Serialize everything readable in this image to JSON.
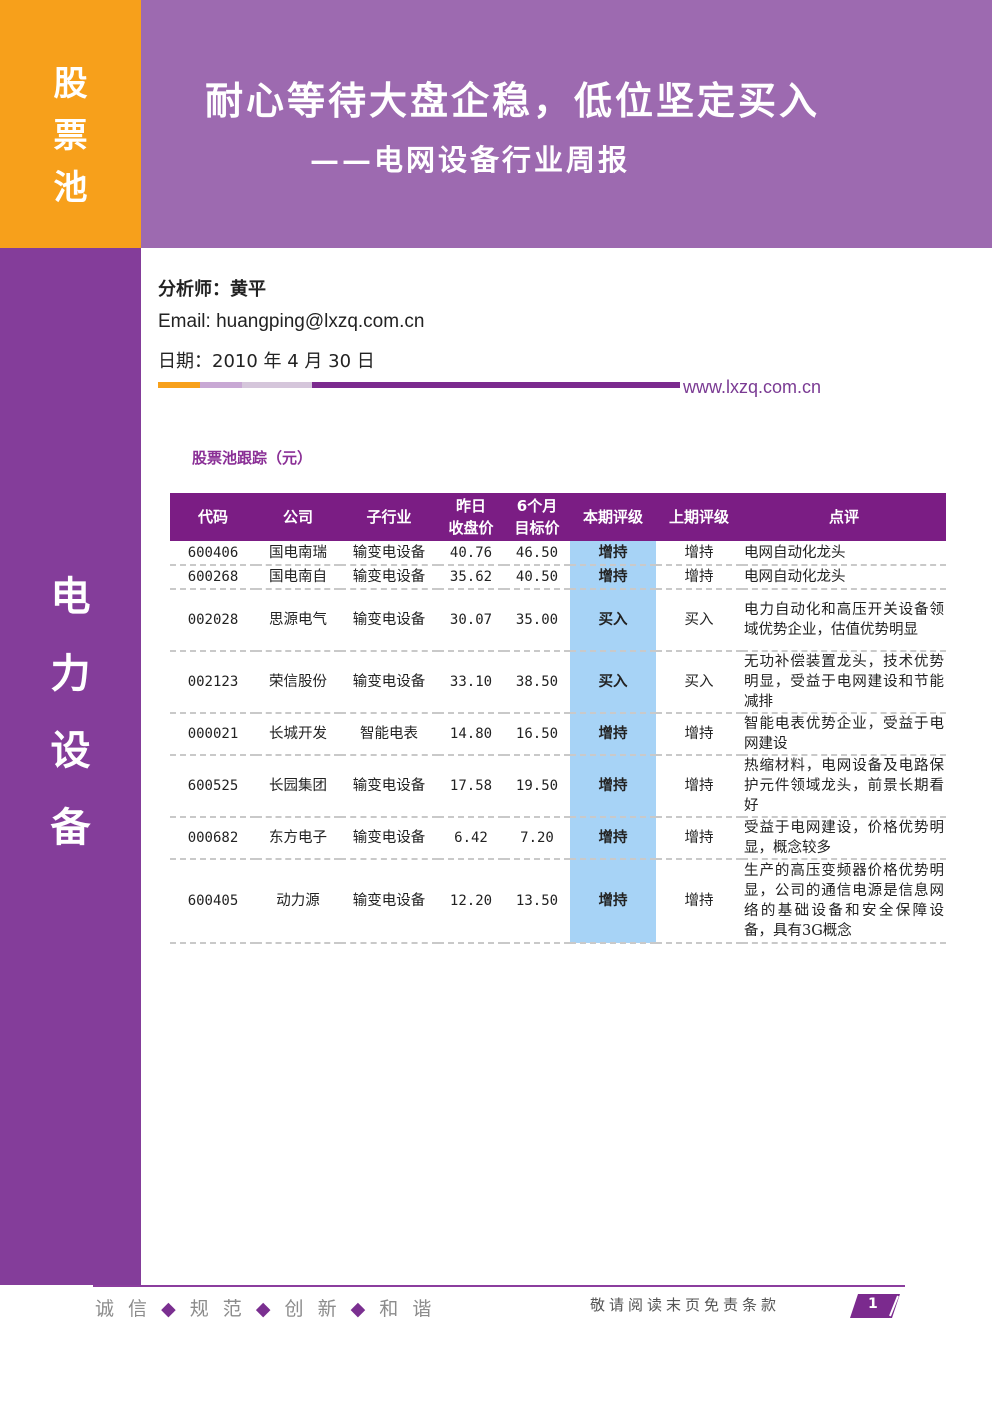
{
  "sidebar_top": {
    "chars": [
      "股",
      "票",
      "池"
    ]
  },
  "sidebar_bottom": {
    "chars": [
      "电",
      "力",
      "设",
      "备"
    ]
  },
  "header": {
    "title": "耐心等待大盘企稳，低位坚定买入",
    "subtitle": "——电网设备行业周报"
  },
  "info": {
    "analyst": "分析师：黄平",
    "email": "Email: huangping@lxzq.com.cn",
    "date": "日期：2010 年 4 月 30 日",
    "website": "www.lxzq.com.cn"
  },
  "colors": {
    "orange": "#f7a01b",
    "title_band": "#9d6ab0",
    "left_bar": "#843d9a",
    "table_header": "#7b1d84",
    "rating_cell": "#a7d3f6"
  },
  "section": {
    "heading": "股票池跟踪（元）"
  },
  "table": {
    "headers": [
      "代码",
      "公司",
      "子行业",
      "昨日\n收盘价",
      "6个月\n目标价",
      "本期评级",
      "上期评级",
      "点评"
    ],
    "rows": [
      {
        "code": "600406",
        "company": "国电南瑞",
        "sub_industry": "输变电设备",
        "close": "40.76",
        "target": "46.50",
        "rating": "增持",
        "prev_rating": "增持",
        "comment": "电网自动化龙头"
      },
      {
        "code": "600268",
        "company": "国电南自",
        "sub_industry": "输变电设备",
        "close": "35.62",
        "target": "40.50",
        "rating": "增持",
        "prev_rating": "增持",
        "comment": "电网自动化龙头"
      },
      {
        "code": "002028",
        "company": "思源电气",
        "sub_industry": "输变电设备",
        "close": "30.07",
        "target": "35.00",
        "rating": "买入",
        "prev_rating": "买入",
        "comment": "电力自动化和高压开关设备领域优势企业，估值优势明显"
      },
      {
        "code": "002123",
        "company": "荣信股份",
        "sub_industry": "输变电设备",
        "close": "33.10",
        "target": "38.50",
        "rating": "买入",
        "prev_rating": "买入",
        "comment": "无功补偿装置龙头，技术优势明显，受益于电网建设和节能减排"
      },
      {
        "code": "000021",
        "company": "长城开发",
        "sub_industry": "智能电表",
        "close": "14.80",
        "target": "16.50",
        "rating": "增持",
        "prev_rating": "增持",
        "comment": "智能电表优势企业，受益于电网建设"
      },
      {
        "code": "600525",
        "company": "长园集团",
        "sub_industry": "输变电设备",
        "close": "17.58",
        "target": "19.50",
        "rating": "增持",
        "prev_rating": "增持",
        "comment": "热缩材料，电网设备及电路保护元件领域龙头，前景长期看好"
      },
      {
        "code": "000682",
        "company": "东方电子",
        "sub_industry": "输变电设备",
        "close": "6.42",
        "target": "7.20",
        "rating": "增持",
        "prev_rating": "增持",
        "comment": "受益于电网建设，价格优势明显，概念较多"
      },
      {
        "code": "600405",
        "company": "动力源",
        "sub_industry": "输变电设备",
        "close": "12.20",
        "target": "13.50",
        "rating": "增持",
        "prev_rating": "增持",
        "comment": "生产的高压变频器价格优势明显，公司的通信电源是信息网络的基础设备和安全保障设备，具有3G概念"
      }
    ]
  },
  "footer": {
    "slogan": [
      "诚 信",
      "规 范",
      "创 新",
      "和 谐"
    ],
    "disclaimer": "敬请阅读末页免责条款",
    "page": "1"
  }
}
